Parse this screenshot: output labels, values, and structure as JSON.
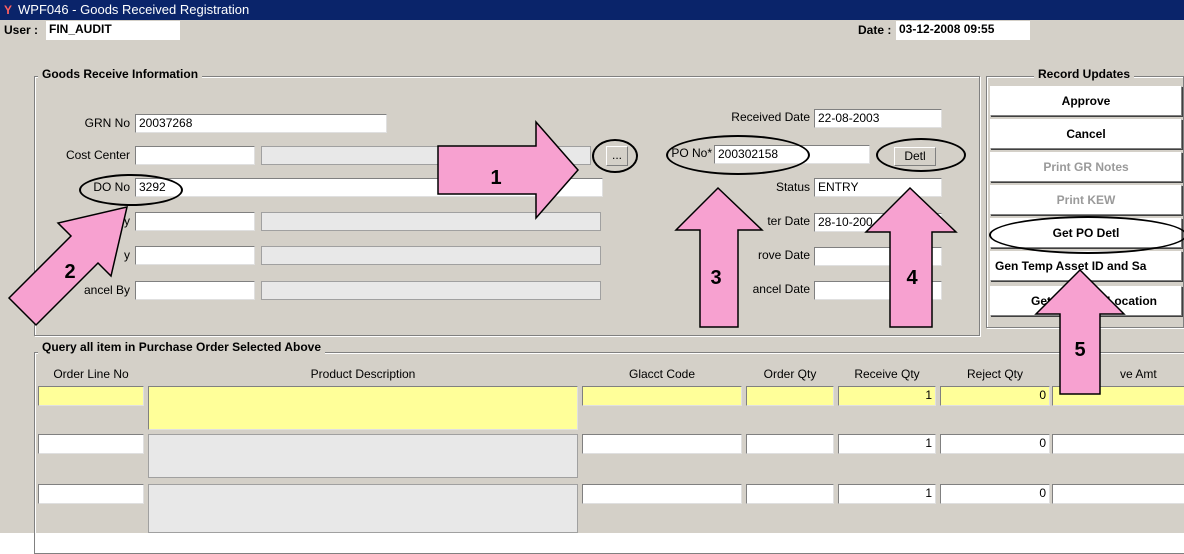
{
  "window": {
    "title": "WPF046 - Goods Received Registration"
  },
  "header": {
    "user_label": "User :",
    "user_value": "FIN_AUDIT",
    "date_label": "Date :",
    "date_value": "03-12-2008 09:55"
  },
  "goods_receive": {
    "group_title": "Goods Receive Information",
    "grn_label": "GRN No",
    "grn_value": "20037268",
    "cost_center_label": "Cost Center",
    "cost_center_value": "",
    "cost_center_desc": "",
    "lookup_label": "...",
    "do_label": "DO No",
    "do_value": "3292",
    "by_label": "By",
    "by_value": "",
    "by_desc": "",
    "row5_label": "y",
    "row5_value": "",
    "row5_desc": "",
    "cancel_by_label": "ancel By",
    "cancel_by_value": "",
    "cancel_by_desc": "",
    "received_date_label": "Received Date",
    "received_date_value": "22-08-2003",
    "po_label": "PO No*",
    "po_value": "200302158",
    "detl_label": "Detl",
    "status_label": "Status",
    "status_value": "ENTRY",
    "register_date_label": "ter Date",
    "register_date_value": "28-10-200",
    "approve_date_label": "rove Date",
    "approve_date_value": "",
    "cancel_date_label": "ancel Date",
    "cancel_date_value": ""
  },
  "record_updates": {
    "group_title": "Record Updates",
    "buttons": [
      "Approve",
      "Cancel",
      "Print GR Notes",
      "Print KEW",
      "Get PO Detl",
      "Gen Temp Asset ID and Sa",
      "Location"
    ],
    "get_location_prefix": "Get"
  },
  "query": {
    "group_title": "Query all item in Purchase Order Selected Above",
    "columns": [
      "Order Line No",
      "Product Description",
      "Glacct Code",
      "Order Qty",
      "Receive Qty",
      "Reject Qty",
      "ve Amt"
    ],
    "rows": [
      {
        "order_line": "",
        "product": "",
        "glacct": "",
        "order_qty": "",
        "receive_qty": "1",
        "reject_qty": "0",
        "amt": ""
      },
      {
        "order_line": "",
        "product": "",
        "glacct": "",
        "order_qty": "",
        "receive_qty": "1",
        "reject_qty": "0",
        "amt": ""
      },
      {
        "order_line": "",
        "product": "",
        "glacct": "",
        "order_qty": "",
        "receive_qty": "1",
        "reject_qty": "0",
        "amt": ""
      }
    ]
  },
  "annotations": {
    "arrow_color": "#f7a1d0",
    "labels": [
      "1",
      "2",
      "3",
      "4",
      "5"
    ]
  }
}
